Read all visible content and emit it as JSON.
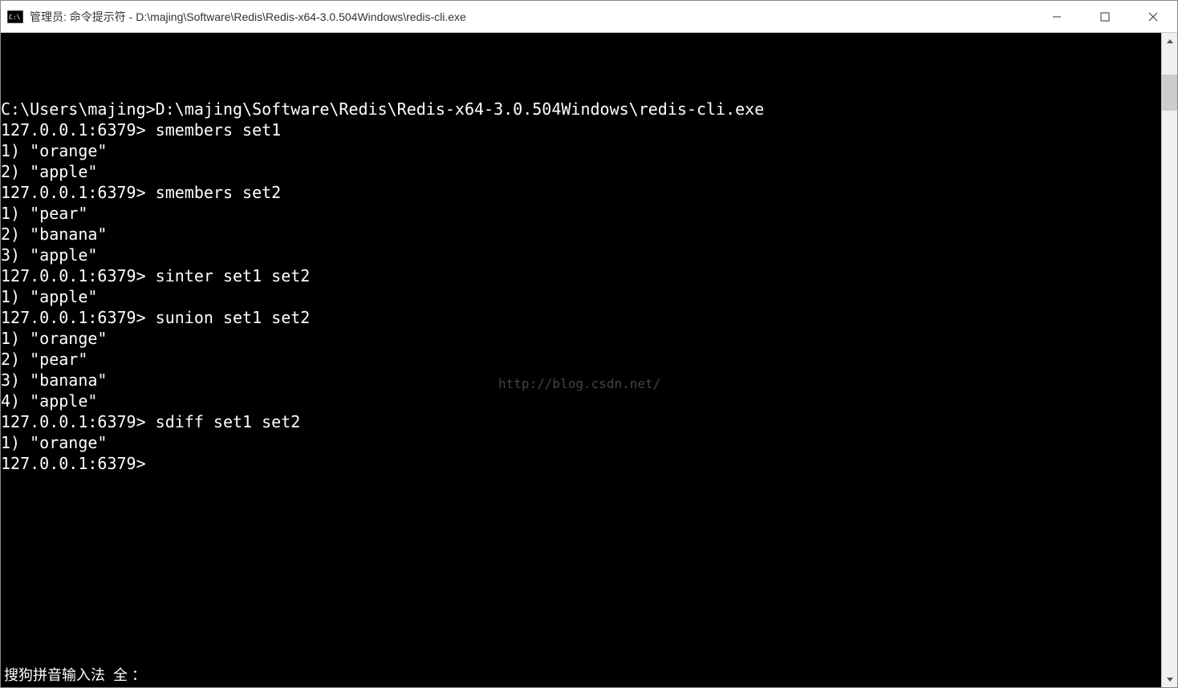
{
  "titlebar": {
    "text": "管理员: 命令提示符 - D:\\majing\\Software\\Redis\\Redis-x64-3.0.504Windows\\redis-cli.exe"
  },
  "terminal": {
    "lines": [
      "C:\\Users\\majing>D:\\majing\\Software\\Redis\\Redis-x64-3.0.504Windows\\redis-cli.exe",
      "127.0.0.1:6379> smembers set1",
      "1) \"orange\"",
      "2) \"apple\"",
      "127.0.0.1:6379> smembers set2",
      "1) \"pear\"",
      "2) \"banana\"",
      "3) \"apple\"",
      "127.0.0.1:6379> sinter set1 set2",
      "1) \"apple\"",
      "127.0.0.1:6379> sunion set1 set2",
      "1) \"orange\"",
      "2) \"pear\"",
      "3) \"banana\"",
      "4) \"apple\"",
      "127.0.0.1:6379> sdiff set1 set2",
      "1) \"orange\"",
      "127.0.0.1:6379>"
    ]
  },
  "watermark": "http://blog.csdn.net/",
  "ime": {
    "text": "搜狗拼音输入法  全 ："
  }
}
